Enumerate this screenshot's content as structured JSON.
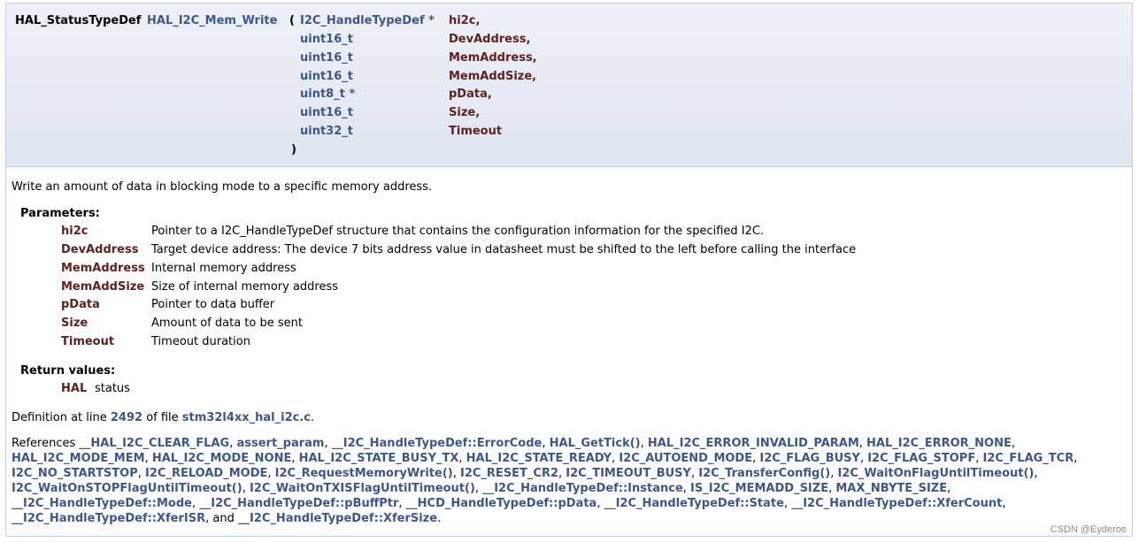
{
  "prototype": {
    "return_type": "HAL_StatusTypeDef",
    "function_name": "HAL_I2C_Mem_Write",
    "open_paren": "(",
    "close_paren": ")",
    "params": [
      {
        "type": "I2C_HandleTypeDef *",
        "name": "hi2c,"
      },
      {
        "type": "uint16_t",
        "name": "DevAddress,"
      },
      {
        "type": "uint16_t",
        "name": "MemAddress,"
      },
      {
        "type": "uint16_t",
        "name": "MemAddSize,"
      },
      {
        "type": "uint8_t *",
        "name": "pData,"
      },
      {
        "type": "uint16_t",
        "name": "Size,"
      },
      {
        "type": "uint32_t",
        "name": "Timeout"
      }
    ]
  },
  "brief": "Write an amount of data in blocking mode to a specific memory address.",
  "parameters": {
    "heading": "Parameters:",
    "items": [
      {
        "name": "hi2c",
        "desc": "Pointer to a I2C_HandleTypeDef structure that contains the configuration information for the specified I2C."
      },
      {
        "name": "DevAddress",
        "desc": "Target device address: The device 7 bits address value in datasheet must be shifted to the left before calling the interface"
      },
      {
        "name": "MemAddress",
        "desc": "Internal memory address"
      },
      {
        "name": "MemAddSize",
        "desc": "Size of internal memory address"
      },
      {
        "name": "pData",
        "desc": "Pointer to data buffer"
      },
      {
        "name": "Size",
        "desc": "Amount of data to be sent"
      },
      {
        "name": "Timeout",
        "desc": "Timeout duration"
      }
    ]
  },
  "return_values": {
    "heading": "Return values:",
    "name": "HAL",
    "desc": "status"
  },
  "definition": {
    "prefix": "Definition at line ",
    "line": "2492",
    "middle": " of file ",
    "file": "stm32l4xx_hal_i2c.c",
    "suffix": "."
  },
  "references": {
    "prefix": "References ",
    "items": [
      "__HAL_I2C_CLEAR_FLAG",
      "assert_param",
      "__I2C_HandleTypeDef::ErrorCode",
      "HAL_GetTick()",
      "HAL_I2C_ERROR_INVALID_PARAM",
      "HAL_I2C_ERROR_NONE",
      "HAL_I2C_MODE_MEM",
      "HAL_I2C_MODE_NONE",
      "HAL_I2C_STATE_BUSY_TX",
      "HAL_I2C_STATE_READY",
      "I2C_AUTOEND_MODE",
      "I2C_FLAG_BUSY",
      "I2C_FLAG_STOPF",
      "I2C_FLAG_TCR",
      "I2C_NO_STARTSTOP",
      "I2C_RELOAD_MODE",
      "I2C_RequestMemoryWrite()",
      "I2C_RESET_CR2",
      "I2C_TIMEOUT_BUSY",
      "I2C_TransferConfig()",
      "I2C_WaitOnFlagUntilTimeout()",
      "I2C_WaitOnSTOPFlagUntilTimeout()",
      "I2C_WaitOnTXISFlagUntilTimeout()",
      "__I2C_HandleTypeDef::Instance",
      "IS_I2C_MEMADD_SIZE",
      "MAX_NBYTE_SIZE",
      "__I2C_HandleTypeDef::Mode",
      "__I2C_HandleTypeDef::pBuffPtr",
      "__HCD_HandleTypeDef::pData",
      "__I2C_HandleTypeDef::State",
      "__I2C_HandleTypeDef::XferCount",
      "__I2C_HandleTypeDef::XferISR",
      "__I2C_HandleTypeDef::XferSize"
    ],
    "and_word": "and",
    "end": "."
  },
  "watermark": "CSDN @Eyderoe",
  "colors": {
    "link": "#3D578C",
    "param_name": "#602020",
    "proto_bg_top": "#EEF1F7",
    "proto_bg_bottom": "#DFE5F1",
    "border": "#C4CFE5"
  }
}
